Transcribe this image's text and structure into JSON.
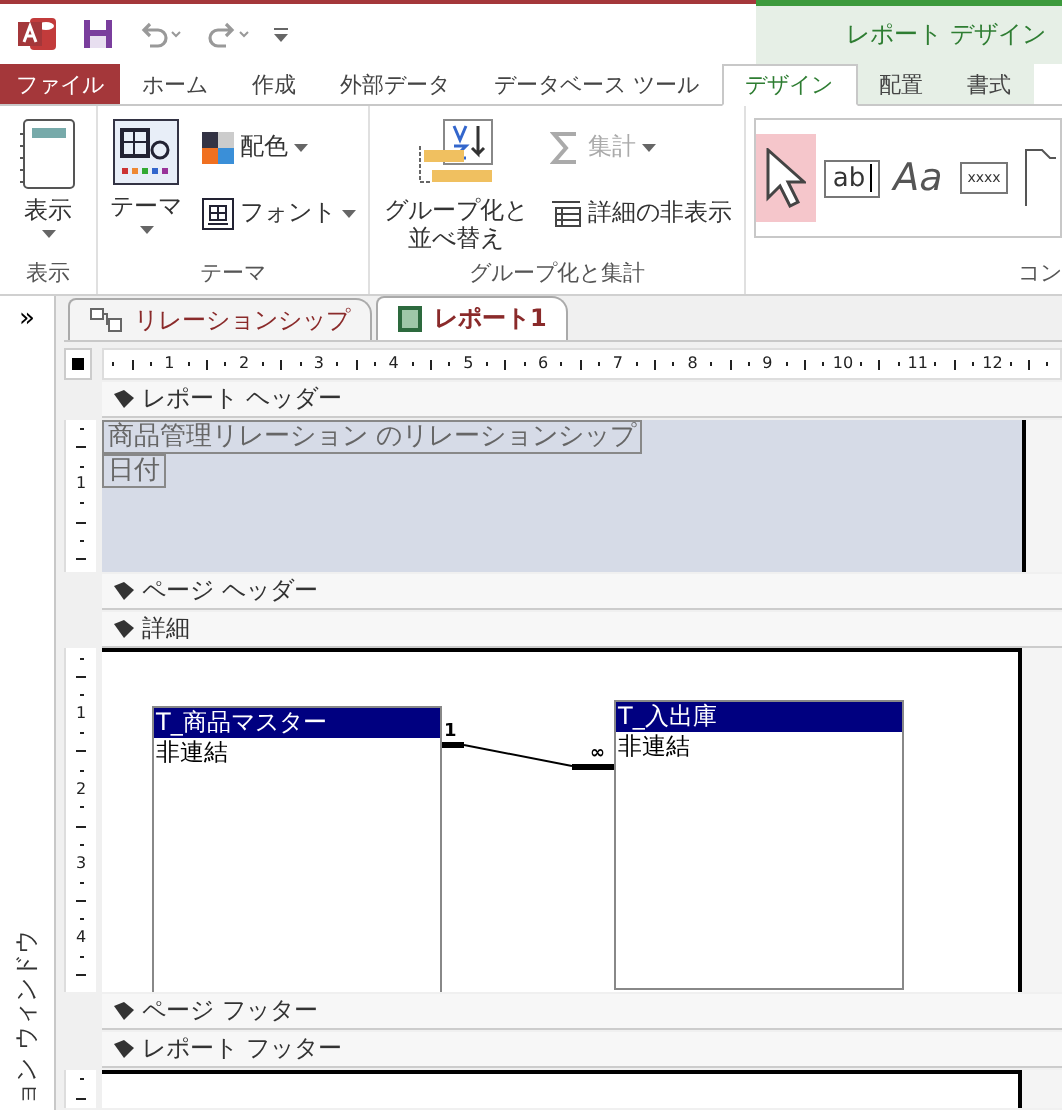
{
  "title_bar": {
    "context_title": "レポート デザイン"
  },
  "tabs": [
    {
      "label": "ファイル",
      "kind": "file",
      "selected": false
    },
    {
      "label": "ホーム",
      "kind": "tab",
      "selected": false
    },
    {
      "label": "作成",
      "kind": "tab",
      "selected": false
    },
    {
      "label": "外部データ",
      "kind": "tab",
      "selected": false
    },
    {
      "label": "データベース ツール",
      "kind": "tab",
      "selected": false
    },
    {
      "label": "デザイン",
      "kind": "contextual",
      "selected": true
    },
    {
      "label": "配置",
      "kind": "contextual",
      "selected": false
    },
    {
      "label": "書式",
      "kind": "contextual",
      "selected": false
    }
  ],
  "ribbon": {
    "groups": [
      {
        "kind": "view",
        "label": "表示",
        "commands": [
          {
            "label": "表示",
            "dropdown": true,
            "disabled": false
          }
        ]
      },
      {
        "kind": "themes",
        "label": "テーマ",
        "commands": [
          {
            "label": "テーマ",
            "dropdown": true,
            "disabled": false
          },
          {
            "label": "配色",
            "dropdown": true,
            "disabled": false
          },
          {
            "label": "フォント",
            "dropdown": true,
            "disabled": false
          }
        ]
      },
      {
        "kind": "grouping",
        "label": "グループ化と集計",
        "commands": [
          {
            "label": "グループ化と並べ替え",
            "disabled": false
          },
          {
            "label": "集計",
            "dropdown": true,
            "disabled": true
          },
          {
            "label": "詳細の非表示",
            "disabled": false
          }
        ]
      },
      {
        "kind": "controls",
        "label": "コン",
        "items": [
          {
            "kind": "pointer",
            "selected": true
          },
          {
            "kind": "textbox",
            "text": "ab",
            "selected": false
          },
          {
            "kind": "label",
            "text": "Aa",
            "selected": false
          },
          {
            "kind": "button",
            "text": "xxxx",
            "selected": false
          },
          {
            "kind": "tab",
            "selected": false
          }
        ]
      }
    ]
  },
  "navigation_pane": {
    "expand_glyph": "»",
    "label": "ョン ウィンドウ"
  },
  "document_tabs": [
    {
      "label": "リレーションシップ",
      "kind": "relationships",
      "selected": false
    },
    {
      "label": "レポート1",
      "kind": "report",
      "selected": true
    }
  ],
  "ruler": {
    "labels": [
      "1",
      "2",
      "3",
      "4",
      "5",
      "6",
      "7",
      "8",
      "9",
      "10",
      "11",
      "12"
    ]
  },
  "sections": [
    {
      "kind": "report_header",
      "label": "レポート ヘッダー",
      "ruler_labels": [
        "1"
      ],
      "controls": [
        {
          "text": "商品管理リレーション のリレーションシップ"
        },
        {
          "text": "日付"
        }
      ]
    },
    {
      "kind": "page_header",
      "label": "ページ ヘッダー"
    },
    {
      "kind": "detail",
      "label": "詳細",
      "ruler_labels": [
        "1",
        "2",
        "3",
        "4"
      ],
      "tables": [
        {
          "name": "T_商品マスター",
          "fields": [
            "非連結"
          ]
        },
        {
          "name": "T_入出庫",
          "fields": [
            "非連結"
          ]
        }
      ],
      "relationship": {
        "one": "1",
        "many": "∞"
      }
    },
    {
      "kind": "page_footer",
      "label": "ページ フッター"
    },
    {
      "kind": "report_footer",
      "label": "レポート フッター"
    }
  ]
}
